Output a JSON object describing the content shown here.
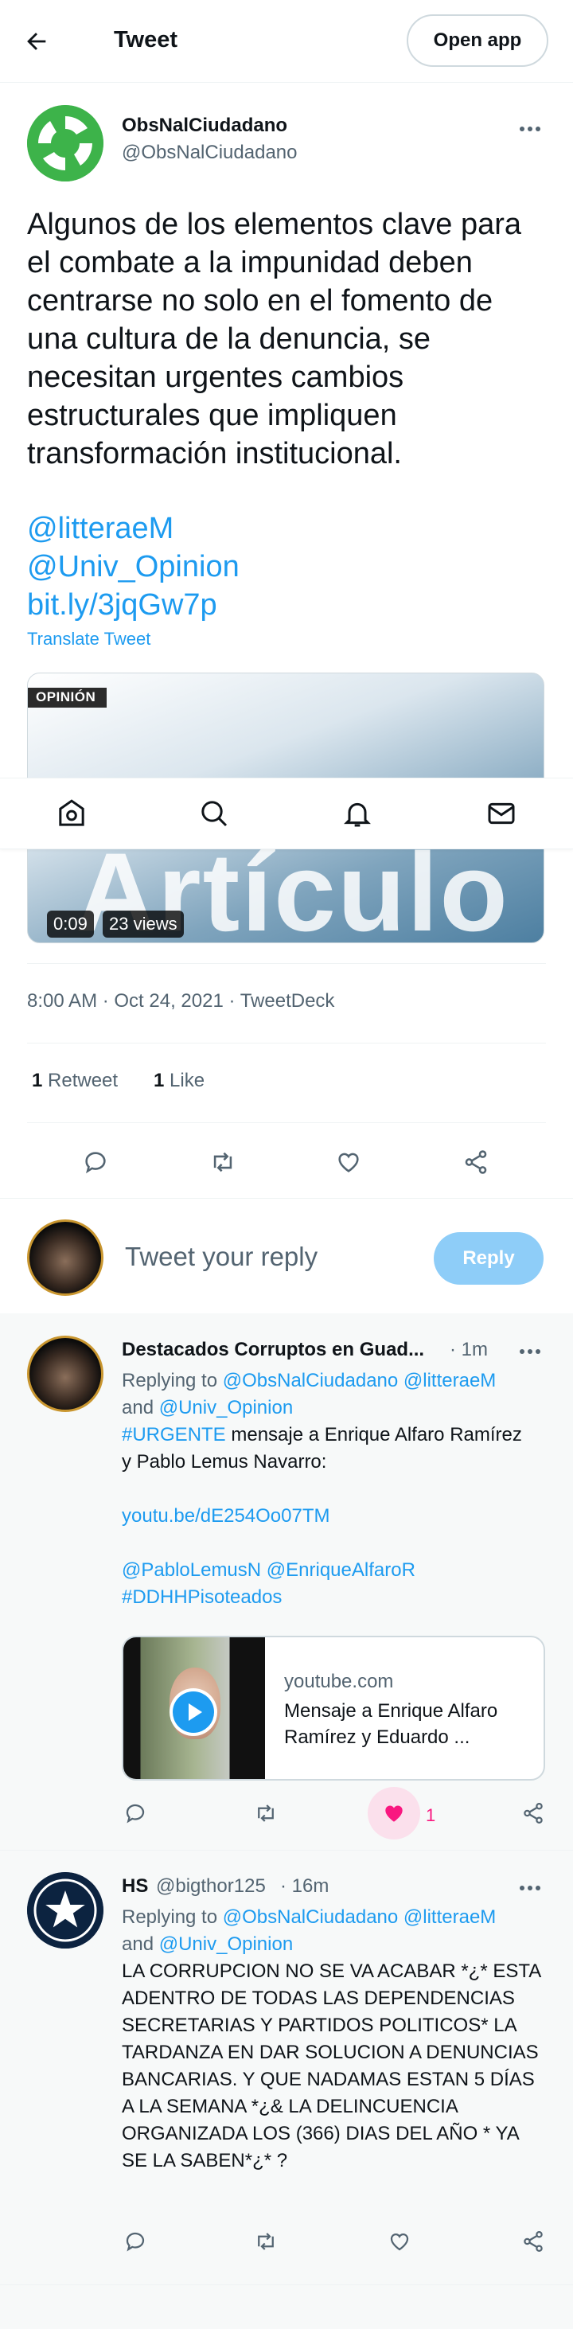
{
  "header": {
    "title": "Tweet",
    "open_app_label": "Open app"
  },
  "tweet": {
    "author_name": "ObsNalCiudadano",
    "author_handle": "@ObsNalCiudadano",
    "text": "Algunos de los elementos clave para el combate a la impunidad deben centrarse no solo en el fomento de una cultura de la denuncia, se necesitan urgentes cambios estructurales que impliquen transformación institucional.",
    "links": [
      "@litteraeM",
      "@Univ_Opinion",
      "bit.ly/3jqGw7p"
    ],
    "translate_label": "Translate Tweet",
    "media": {
      "tag": "OPINIÓN",
      "overlay_text": "Artículo",
      "duration": "0:09",
      "views": "23 views"
    },
    "timestamp": "8:00 AM · Oct 24, 2021 · TweetDeck",
    "retweets_count": "1",
    "retweets_label": "Retweet",
    "likes_count": "1",
    "likes_label": "Like"
  },
  "bottom_nav": {
    "items": [
      "home",
      "explore",
      "notifications",
      "messages"
    ]
  },
  "composer": {
    "placeholder": "Tweet your reply",
    "reply_label": "Reply"
  },
  "replies": [
    {
      "name": "Destacados Corruptos en Guad...",
      "time": "· 1m",
      "replying_prefix": "Replying to",
      "replying_to_1": "@ObsNalCiudadano @litteraeM",
      "replying_and": "and",
      "replying_to_2": "@Univ_Opinion",
      "hashtag": "#URGENTE",
      "text_line1": "mensaje a Enrique Alfaro Ramírez",
      "text_line2": "y Pablo Lemus Navarro:",
      "link": "youtu.be/dE254Oo07TM",
      "mentions": "@PabloLemusN @EnriqueAlfaroR",
      "hashtag2": "#DDHHPisoteados",
      "card": {
        "domain": "youtube.com",
        "title": "Mensaje a Enrique Alfaro Ramírez y Eduardo ..."
      },
      "like_count": "1",
      "like_color": "#f91880"
    },
    {
      "name": "HS",
      "handle": "@bigthor125",
      "time": "· 16m",
      "replying_prefix": "Replying to",
      "replying_to_1": "@ObsNalCiudadano @litteraeM",
      "replying_and": "and",
      "replying_to_2": "@Univ_Opinion",
      "text": "LA CORRUPCION NO SE VA ACABAR *¿* ESTA ADENTRO DE TODAS LAS DEPENDENCIAS SECRETARIAS Y PARTIDOS POLITICOS* LA TARDANZA EN DAR SOLUCION A DENUNCIAS BANCARIAS. Y QUE NADAMAS ESTAN 5 DÍAS A LA SEMANA *¿& LA DELINCUENCIA ORGANIZADA LOS (366) DIAS DEL AÑO * YA SE LA SABEN*¿* ?"
    }
  ],
  "colors": {
    "accent": "#1d9bf0",
    "text": "#0f1419",
    "secondary": "#536471",
    "like": "#f91880",
    "brand_avatar": "#3db34a"
  }
}
